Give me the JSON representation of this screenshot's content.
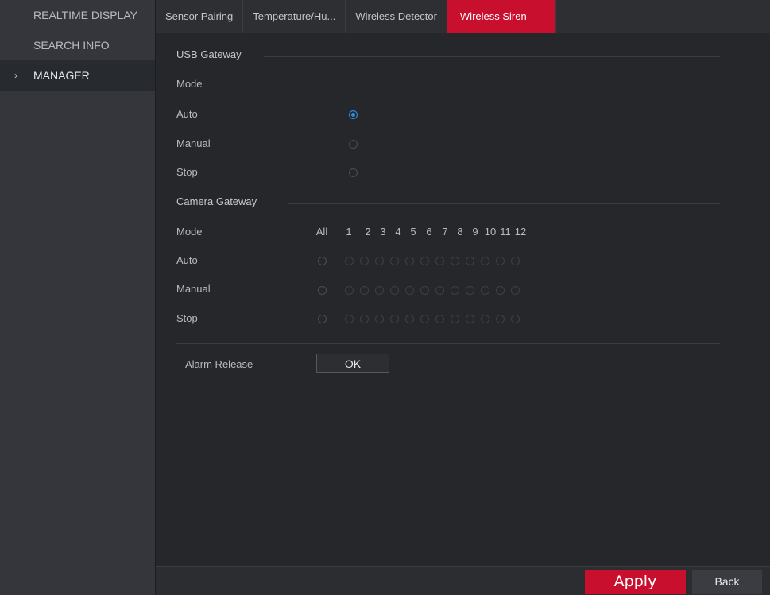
{
  "sidebar": {
    "items": [
      {
        "label": "REALTIME DISPLAY"
      },
      {
        "label": "SEARCH INFO"
      },
      {
        "label": "MANAGER",
        "active": true,
        "icon": "chevron-right-icon",
        "glyph": "›"
      }
    ]
  },
  "tabs": [
    {
      "label": "Sensor Pairing"
    },
    {
      "label": "Temperature/Hu..."
    },
    {
      "label": "Wireless Detector"
    },
    {
      "label": "Wireless Siren",
      "active": true
    }
  ],
  "usb_gateway": {
    "title": "USB Gateway",
    "mode_label": "Mode",
    "options": [
      {
        "label": "Auto",
        "selected": true
      },
      {
        "label": "Manual",
        "selected": false
      },
      {
        "label": "Stop",
        "selected": false
      }
    ]
  },
  "camera_gateway": {
    "title": "Camera Gateway",
    "mode_label": "Mode",
    "columns": [
      "All",
      "1",
      "2",
      "3",
      "4",
      "5",
      "6",
      "7",
      "8",
      "9",
      "10",
      "11",
      "12"
    ],
    "rows": [
      {
        "label": "Auto"
      },
      {
        "label": "Manual"
      },
      {
        "label": "Stop"
      }
    ]
  },
  "alarm_release": {
    "label": "Alarm Release",
    "button_label": "OK"
  },
  "footer": {
    "apply_label": "Apply",
    "back_label": "Back"
  },
  "colors": {
    "accent": "#c8102e",
    "radio_selected": "#2d8de3",
    "background": "#25272b",
    "sidebar": "#34363b"
  }
}
